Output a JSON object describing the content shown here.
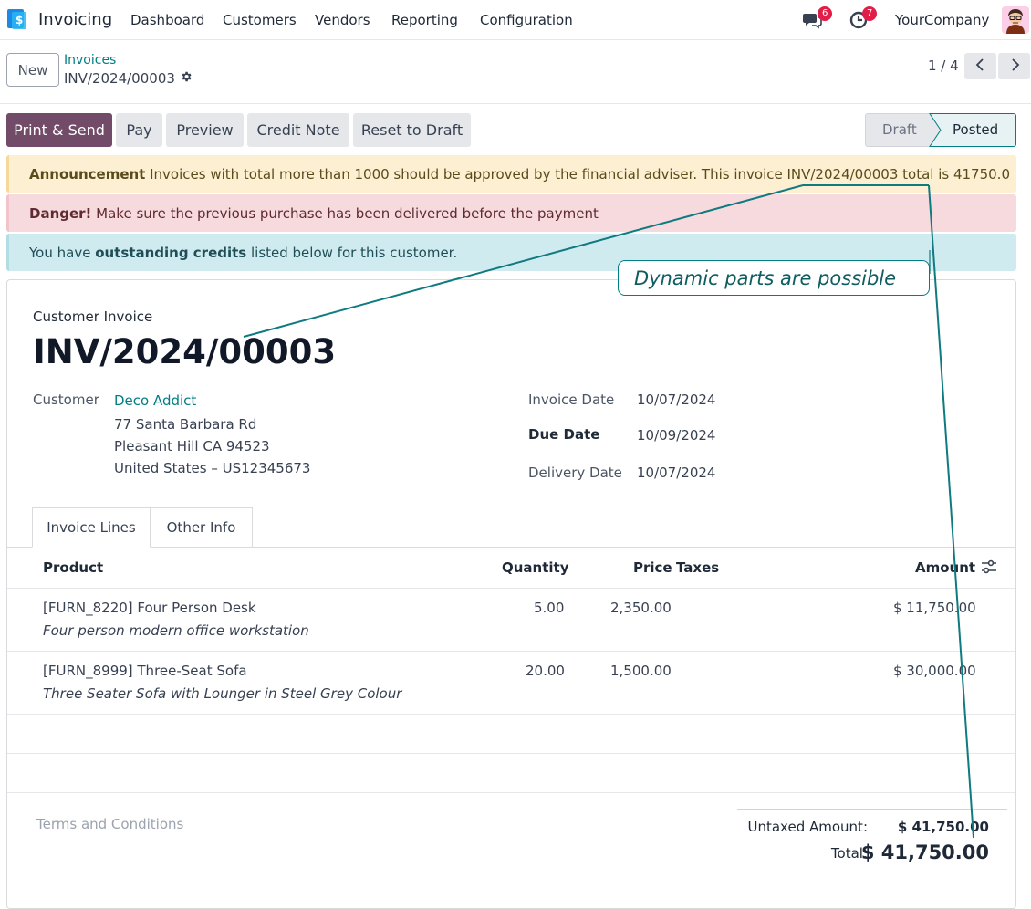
{
  "nav": {
    "app_name": "Invoicing",
    "menu": [
      "Dashboard",
      "Customers",
      "Vendors",
      "Reporting",
      "Configuration"
    ],
    "messages_badge": "6",
    "activities_badge": "7",
    "company": "YourCompany"
  },
  "control": {
    "new_label": "New",
    "breadcrumb_parent": "Invoices",
    "breadcrumb_current": "INV/2024/00003",
    "pager": "1 / 4"
  },
  "actions": {
    "print_send": "Print & Send",
    "pay": "Pay",
    "preview": "Preview",
    "credit_note": "Credit Note",
    "reset": "Reset to Draft"
  },
  "status": {
    "draft": "Draft",
    "posted": "Posted"
  },
  "alerts": {
    "announcement_bold": "Announcement",
    "announcement_text": " Invoices with total more than 1000 should be approved by the financial adviser. This invoice INV/2024/00003 total is 41750.0",
    "danger_bold": "Danger!",
    "danger_text": " Make sure the previous purchase has been delivered before the payment",
    "info_pre": "You have ",
    "info_bold": "outstanding credits",
    "info_post": " listed below for this customer."
  },
  "callout": "Dynamic parts are possible",
  "invoice": {
    "type_label": "Customer Invoice",
    "number": "INV/2024/00003",
    "customer_label": "Customer",
    "customer_name": "Deco Addict",
    "address": [
      "77 Santa Barbara Rd",
      "Pleasant Hill CA 94523",
      "United States – US12345673"
    ],
    "invoice_date_label": "Invoice Date",
    "invoice_date": "10/07/2024",
    "due_date_label": "Due Date",
    "due_date": "10/09/2024",
    "delivery_date_label": "Delivery Date",
    "delivery_date": "10/07/2024"
  },
  "tabs": [
    "Invoice Lines",
    "Other Info"
  ],
  "table": {
    "headers": {
      "product": "Product",
      "quantity": "Quantity",
      "price": "Price",
      "taxes": "Taxes",
      "amount": "Amount"
    },
    "rows": [
      {
        "product": "[FURN_8220] Four Person Desk",
        "description": "Four person modern office workstation",
        "quantity": "5.00",
        "price": "2,350.00",
        "amount": "$ 11,750.00"
      },
      {
        "product": "[FURN_8999] Three-Seat Sofa",
        "description": "Three Seater Sofa with Lounger in Steel Grey Colour",
        "quantity": "20.00",
        "price": "1,500.00",
        "amount": "$ 30,000.00"
      }
    ]
  },
  "footer": {
    "terms_placeholder": "Terms and Conditions",
    "untaxed_label": "Untaxed Amount:",
    "untaxed_value": "$ 41,750.00",
    "total_label": "Total:",
    "total_value": "$ 41,750.00"
  },
  "colors": {
    "brand": "#714b67",
    "link": "#017e84",
    "badge": "#e11d48"
  }
}
